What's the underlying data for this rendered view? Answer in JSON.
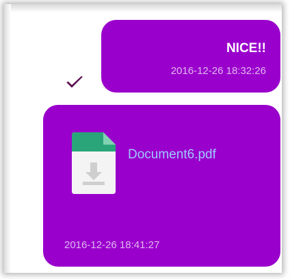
{
  "messages": [
    {
      "text": "NICE!!",
      "timestamp": "2016-12-26 18:32:26",
      "status_icon": "checkmark-icon"
    },
    {
      "file_name": "Document6.pdf",
      "file_icon": "document-download-icon",
      "timestamp": "2016-12-26 18:41:27"
    }
  ],
  "colors": {
    "bubble": "#9a00cc",
    "timestamp": "#e2b9f1",
    "link": "#9ecbff",
    "check": "#5a1050"
  }
}
